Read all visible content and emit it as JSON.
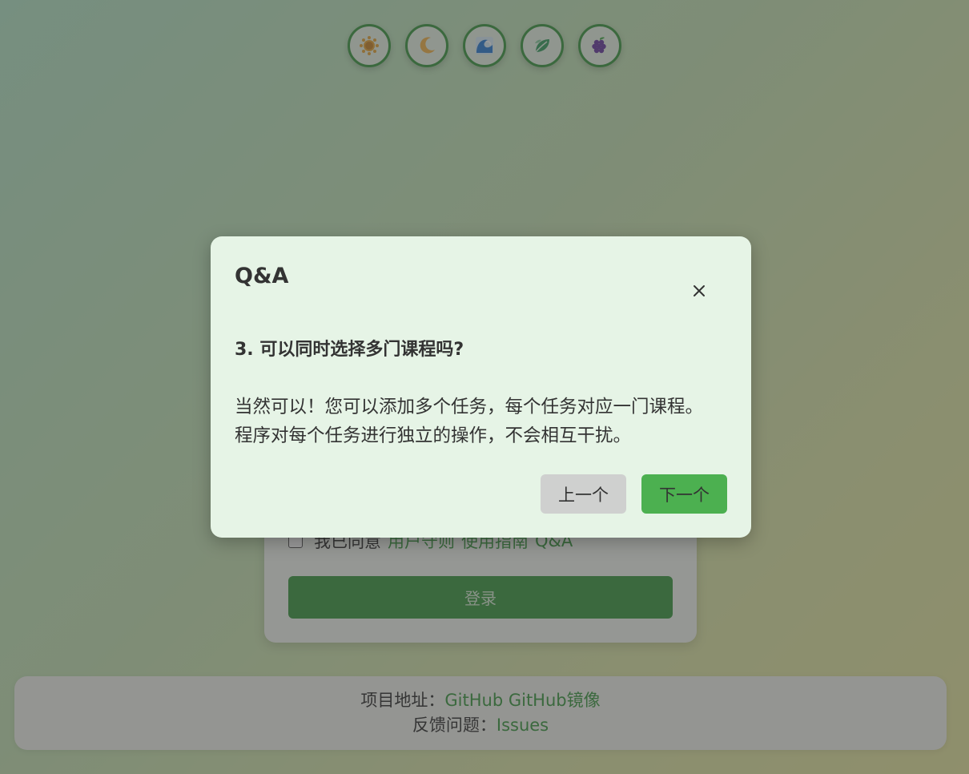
{
  "themes": [
    {
      "icon": "sun-icon",
      "color": "#e6a63a"
    },
    {
      "icon": "moon-icon",
      "color": "#f2b44d"
    },
    {
      "icon": "wave-icon",
      "color": "#2f7fd4"
    },
    {
      "icon": "leaf-icon",
      "color": "#3aa062"
    },
    {
      "icon": "grapes-icon",
      "color": "#6b3fa0"
    }
  ],
  "login": {
    "agree_text": "我已同意",
    "user_agreement": "用户守则",
    "usage_guide": "使用指南",
    "qa_link": "Q&A",
    "login_label": "登录"
  },
  "footer": {
    "project_label": "项目地址：",
    "github": "GitHub",
    "github_mirror": "GitHub镜像",
    "feedback_label": "反馈问题：",
    "issues": "Issues"
  },
  "modal": {
    "title": "Q&A",
    "question": "3. 可以同时选择多门课程吗?",
    "answer": "当然可以！您可以添加多个任务，每个任务对应一门课程。程序对每个任务进行独立的操作，不会相互干扰。",
    "prev_label": "上一个",
    "next_label": "下一个"
  },
  "colors": {
    "accent": "#3e9b45",
    "next_button": "#4cb050",
    "prev_button": "#cfd0cf",
    "modal_bg": "#e6f4e6"
  }
}
